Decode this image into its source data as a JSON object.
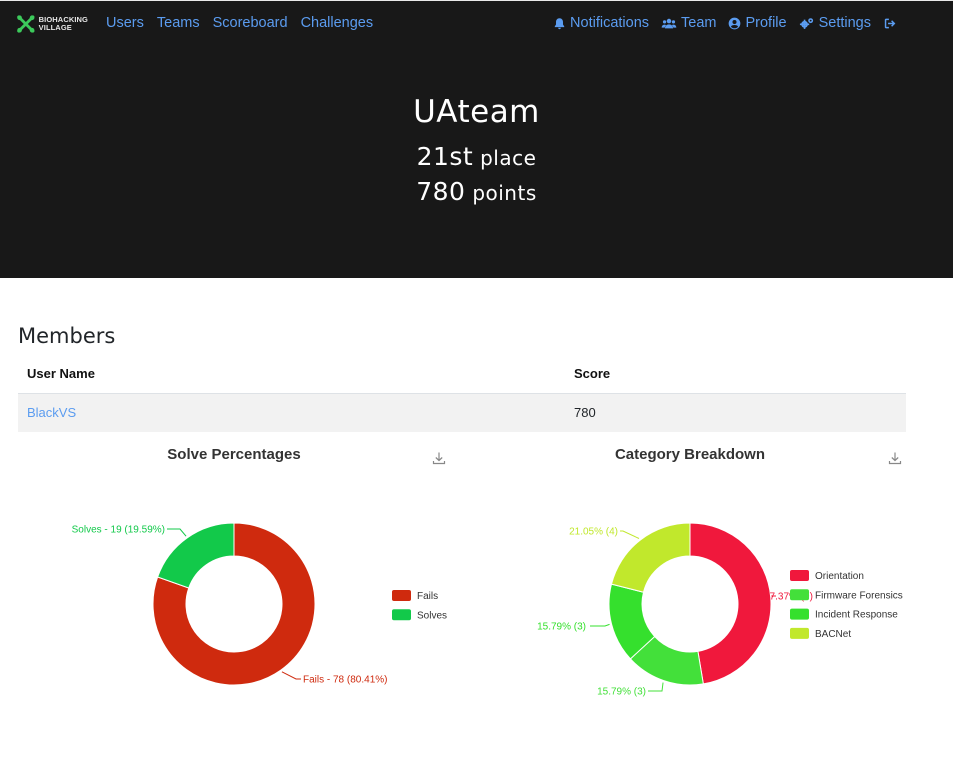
{
  "brand": {
    "line1": "BIOHACKING",
    "line2": "VILLAGE",
    "accent": "#3cc95b"
  },
  "nav": {
    "left": [
      {
        "label": "Users"
      },
      {
        "label": "Teams"
      },
      {
        "label": "Scoreboard"
      },
      {
        "label": "Challenges"
      }
    ],
    "right": [
      {
        "label": "Notifications",
        "icon": "bell-icon"
      },
      {
        "label": "Team",
        "icon": "users-icon"
      },
      {
        "label": "Profile",
        "icon": "user-circle-icon"
      },
      {
        "label": "Settings",
        "icon": "cogs-icon"
      }
    ],
    "logout_icon": "sign-out-icon",
    "link_color": "#5b9cf0"
  },
  "hero": {
    "team_name": "UAteam",
    "place_num": "21st",
    "place_label": "place",
    "points_num": "780",
    "points_label": "points"
  },
  "members": {
    "title": "Members",
    "columns": [
      "User Name",
      "Score"
    ],
    "rows": [
      {
        "name": "BlackVS",
        "score": "780"
      }
    ]
  },
  "charts": {
    "solve": {
      "title": "Solve Percentages",
      "download_icon": "download-icon"
    },
    "category": {
      "title": "Category Breakdown",
      "download_icon": "download-icon"
    }
  },
  "chart_data": [
    {
      "type": "pie",
      "title": "Solve Percentages",
      "slices": [
        {
          "name": "Fails",
          "value": 78,
          "label": "Fails - 78 (80.41%)",
          "color": "#cf2a0e"
        },
        {
          "name": "Solves",
          "value": 19,
          "label": "Solves - 19 (19.59%)",
          "color": "#12c94a"
        }
      ],
      "legend": "right"
    },
    {
      "type": "pie",
      "title": "Category Breakdown",
      "slices": [
        {
          "name": "Orientation",
          "value": 9,
          "label": "47.37% (9)",
          "color": "#f0183c"
        },
        {
          "name": "Firmware Forensics",
          "value": 3,
          "label": "15.79% (3)",
          "color": "#43e03a"
        },
        {
          "name": "Incident Response",
          "value": 3,
          "label": "15.79% (3)",
          "color": "#35e02d"
        },
        {
          "name": "BACNet",
          "value": 4,
          "label": "21.05% (4)",
          "color": "#c1e82c"
        }
      ],
      "legend": "right"
    }
  ]
}
